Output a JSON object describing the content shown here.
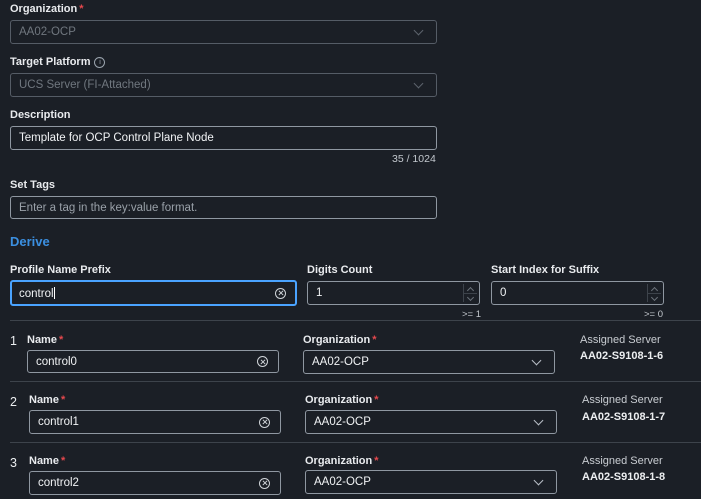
{
  "general": {
    "organization_label": "Organization",
    "organization_value": "AA02-OCP",
    "target_platform_label": "Target Platform",
    "target_platform_value": "UCS Server (FI-Attached)",
    "description_label": "Description",
    "description_value": "Template for OCP Control Plane Node",
    "description_counter": "35 / 1024",
    "set_tags_label": "Set Tags",
    "set_tags_placeholder": "Enter a tag in the key:value format."
  },
  "derive": {
    "title": "Derive",
    "prefix_label": "Profile Name Prefix",
    "prefix_value": "control",
    "digits_label": "Digits Count",
    "digits_value": "1",
    "digits_hint": ">= 1",
    "start_label": "Start Index for Suffix",
    "start_value": "0",
    "start_hint": ">= 0"
  },
  "profiles": {
    "name_label": "Name",
    "org_label": "Organization",
    "server_label": "Assigned Server",
    "rows": [
      {
        "index": "1",
        "name": "control0",
        "org": "AA02-OCP",
        "server": "AA02-S9108-1-6"
      },
      {
        "index": "2",
        "name": "control1",
        "org": "AA02-OCP",
        "server": "AA02-S9108-1-7"
      },
      {
        "index": "3",
        "name": "control2",
        "org": "AA02-OCP",
        "server": "AA02-S9108-1-8"
      }
    ]
  }
}
